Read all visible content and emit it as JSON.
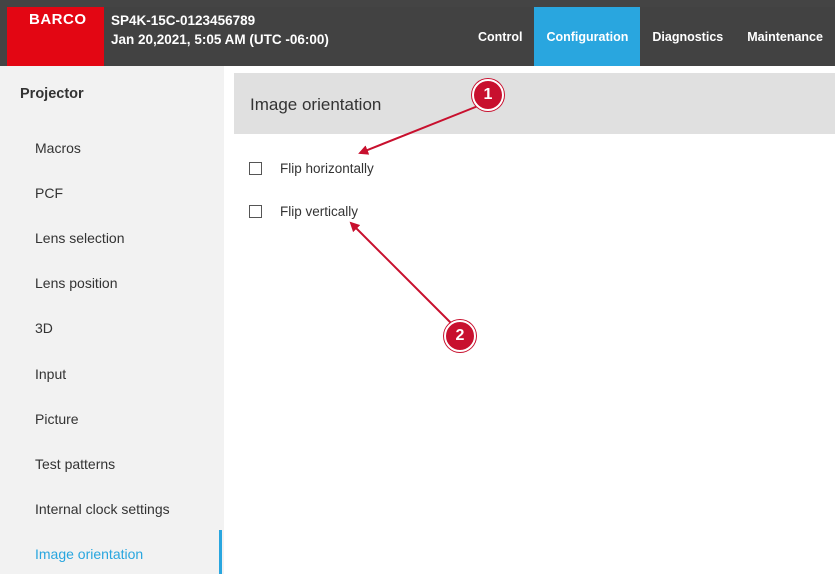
{
  "header": {
    "logo": "BARCO",
    "device_name": "SP4K-15C-0123456789",
    "datetime": "Jan 20,2021, 5:05 AM (UTC -06:00)",
    "nav": [
      {
        "label": "Control",
        "active": false
      },
      {
        "label": "Configuration",
        "active": true
      },
      {
        "label": "Diagnostics",
        "active": false
      },
      {
        "label": "Maintenance",
        "active": false
      }
    ]
  },
  "sidebar": {
    "title": "Projector",
    "items": [
      {
        "label": "Macros"
      },
      {
        "label": "PCF"
      },
      {
        "label": "Lens selection"
      },
      {
        "label": "Lens position"
      },
      {
        "label": "3D"
      },
      {
        "label": "Input"
      },
      {
        "label": "Picture"
      },
      {
        "label": "Test patterns"
      },
      {
        "label": "Internal clock settings"
      },
      {
        "label": "Image orientation",
        "active": true
      }
    ]
  },
  "main": {
    "title": "Image orientation",
    "options": [
      {
        "label": "Flip horizontally",
        "checked": false
      },
      {
        "label": "Flip vertically",
        "checked": false
      }
    ]
  },
  "callouts": [
    "1",
    "2"
  ],
  "colors": {
    "brand_red": "#e30613",
    "accent_blue": "#29a6df",
    "header_bg": "#424242",
    "callout_red": "#c8102e"
  }
}
